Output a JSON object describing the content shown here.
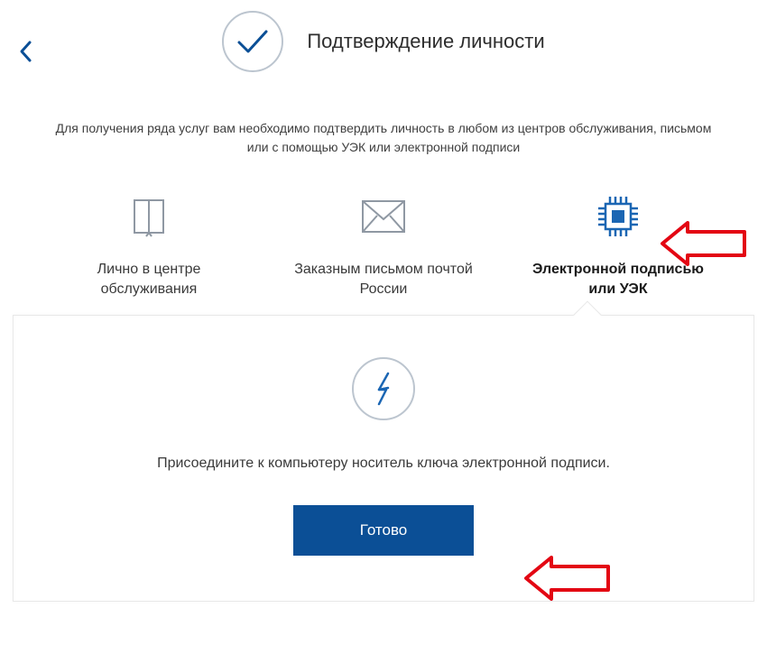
{
  "header": {
    "title": "Подтверждение личности"
  },
  "subtitle": "Для получения ряда услуг вам необходимо подтвердить личность в любом из центров обслуживания, письмом или с помощью УЭК или электронной подписи",
  "options": {
    "in_person": "Лично в центре обслуживания",
    "by_mail": "Заказным письмом почтой России",
    "by_signature": "Электронной подписью или УЭК"
  },
  "panel": {
    "instruction": "Присоедините к компьютеру носитель ключа электронной подписи.",
    "button": "Готово"
  },
  "colors": {
    "primary": "#0b4f96",
    "icon_blue": "#1b66b3",
    "accent_red": "#e30613"
  }
}
